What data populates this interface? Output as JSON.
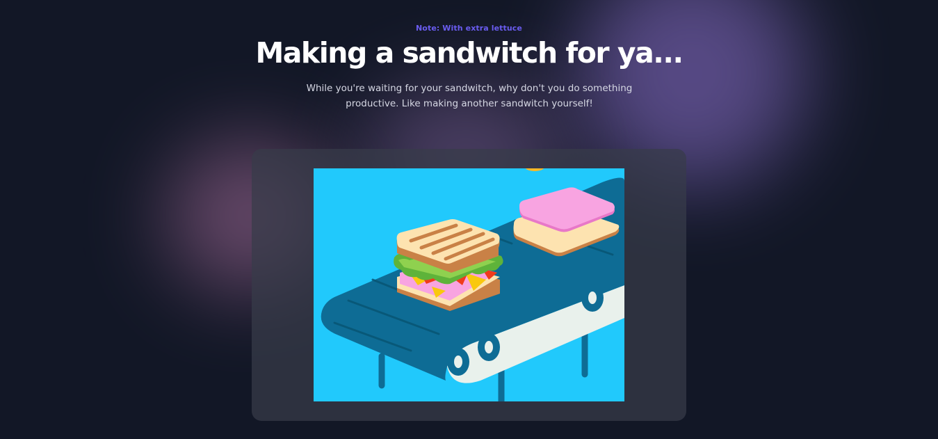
{
  "header": {
    "note": "Note: With extra lettuce",
    "title": "Making a sandwitch for ya...",
    "subtitle": "While you're waiting for your sandwitch, why don't you do something productive. Like making another sandwitch yourself!"
  },
  "illustration": {
    "icon": "sandwich-conveyor-illustration",
    "background_color": "#21c9fc"
  }
}
